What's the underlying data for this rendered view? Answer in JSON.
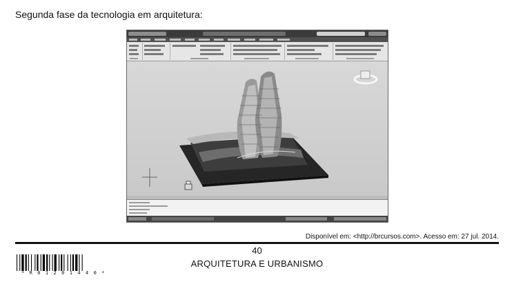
{
  "heading": "Segunda fase da tecnologia em arquitetura:",
  "source": "Disponível em: <http://brcursos.com>. Acesso em: 27 jul. 2014.",
  "page_number": "40",
  "subject": "ARQUITETURA E URBANISMO",
  "barcode_text": "* R 0 1 2 0 1 4 4 0 *",
  "figure": {
    "description_icon": "cad-3d-model-screenshot",
    "background": "#d3d3d3"
  }
}
